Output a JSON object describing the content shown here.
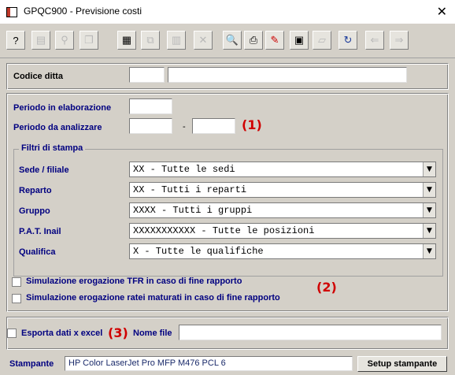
{
  "window": {
    "title": "GPQC900 - Previsione costi",
    "close_glyph": "✕"
  },
  "toolbar": {
    "buttons": [
      {
        "icon": "help-icon",
        "glyph": "?"
      },
      {
        "icon": "properties-icon",
        "glyph": "▤"
      },
      {
        "icon": "find-icon",
        "glyph": "⚲"
      },
      {
        "icon": "copy-icon",
        "glyph": "❐"
      },
      {
        "icon": "calculator-icon",
        "glyph": "▦"
      },
      {
        "icon": "duplicate-icon",
        "glyph": "⧉"
      },
      {
        "icon": "grid-icon",
        "glyph": "▥"
      },
      {
        "icon": "delete-icon",
        "glyph": "✕"
      },
      {
        "icon": "preview-icon",
        "glyph": "🔍"
      },
      {
        "icon": "print-icon",
        "glyph": "⎙"
      },
      {
        "icon": "pdf-icon",
        "glyph": "✎"
      },
      {
        "icon": "export-icon",
        "glyph": "▣"
      },
      {
        "icon": "open-folder-icon",
        "glyph": "▱"
      },
      {
        "icon": "refresh-icon",
        "glyph": "↻"
      },
      {
        "icon": "arrow-left-icon",
        "glyph": "⇐"
      },
      {
        "icon": "arrow-right-icon",
        "glyph": "⇒"
      }
    ]
  },
  "company": {
    "label": "Codice ditta",
    "code": "",
    "name": ""
  },
  "period": {
    "processing_label": "Periodo in elaborazione",
    "processing_value": "",
    "analyze_label": "Periodo da analizzare",
    "from": "",
    "separator": "-",
    "to": "",
    "marker": "(1)"
  },
  "filters": {
    "title": "Filtri di stampa",
    "rows": [
      {
        "label": "Sede / filiale",
        "value": "XX - Tutte le sedi"
      },
      {
        "label": "Reparto",
        "value": "XX - Tutti i reparti"
      },
      {
        "label": "Gruppo",
        "value": "XXXX - Tutti i gruppi"
      },
      {
        "label": "P.A.T. Inail",
        "value": "XXXXXXXXXXX - Tutte le posizioni"
      },
      {
        "label": "Qualifica",
        "value": "X - Tutte le qualifiche"
      }
    ],
    "dropdown_glyph": "▼"
  },
  "simulation": {
    "tfr_label": "Simulazione erogazione TFR in caso di fine rapporto",
    "ratei_label": "Simulazione erogazione ratei maturati in caso di fine rapporto",
    "marker": "(2)"
  },
  "export": {
    "label": "Esporta dati x excel",
    "marker": "(3)",
    "file_label": "Nome file",
    "file_value": ""
  },
  "printer": {
    "label": "Stampante",
    "value": "HP Color LaserJet Pro MFP M476 PCL 6",
    "setup_button": "Setup stampante"
  }
}
